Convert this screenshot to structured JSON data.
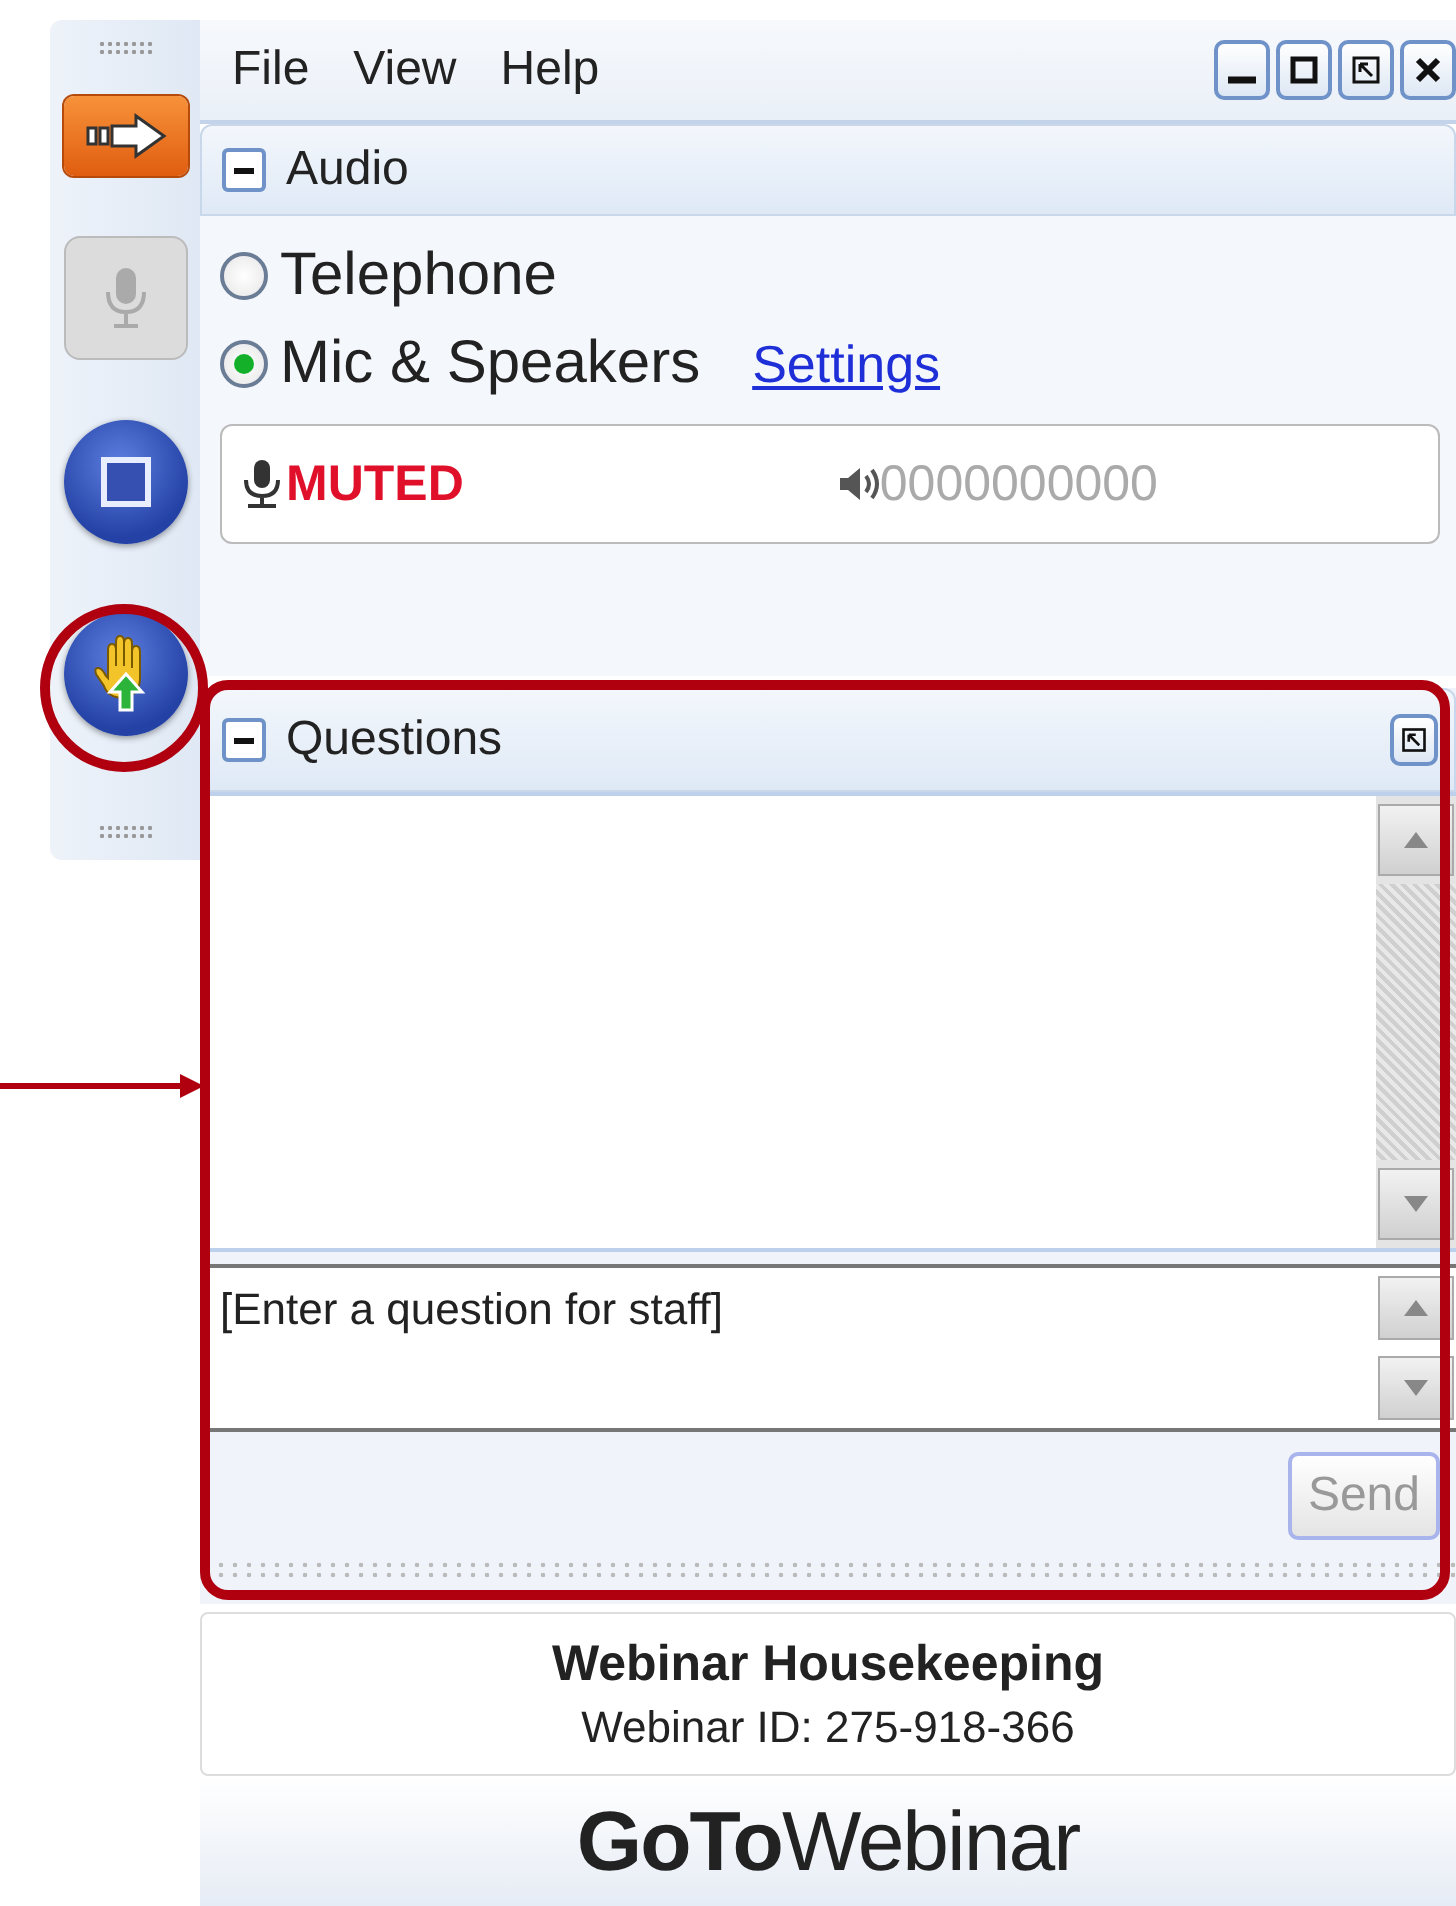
{
  "menu": [
    "File",
    "View",
    "Help"
  ],
  "audio": {
    "title": "Audio",
    "expanded": true,
    "options": [
      {
        "label": "Telephone",
        "selected": false
      },
      {
        "label": "Mic & Speakers",
        "selected": true
      }
    ],
    "settings_link": "Settings",
    "mic_status": "MUTED",
    "speaker_meter": "0000000000"
  },
  "questions": {
    "title": "Questions",
    "expanded": true,
    "placeholder": "[Enter a question for staff]",
    "send_button": {
      "label": "Send",
      "disabled": true
    }
  },
  "footer": {
    "title": "Webinar Housekeeping",
    "webinar_id": "Webinar ID: 275-918-366",
    "logo": "**GoTo**Webinar"
  }
}
